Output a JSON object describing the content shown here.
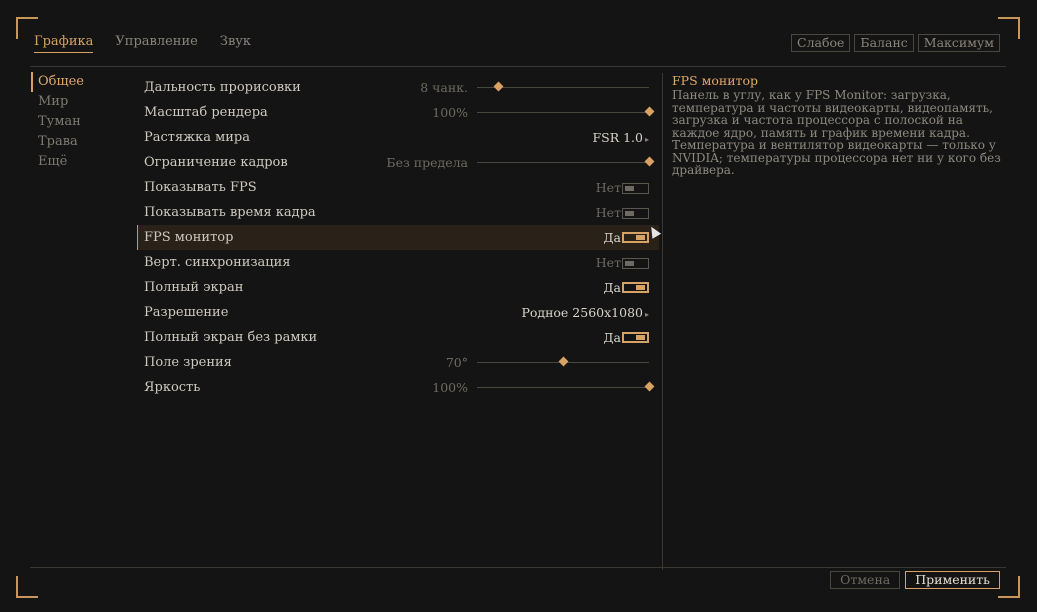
{
  "tabs": [
    {
      "label": "Графика",
      "active": true
    },
    {
      "label": "Управление",
      "active": false
    },
    {
      "label": "Звук",
      "active": false
    }
  ],
  "presets": [
    "Слабое",
    "Баланс",
    "Максимум"
  ],
  "sidebar": [
    {
      "label": "Общее",
      "active": true
    },
    {
      "label": "Мир",
      "active": false
    },
    {
      "label": "Туман",
      "active": false
    },
    {
      "label": "Трава",
      "active": false
    },
    {
      "label": "Ещё",
      "active": false
    }
  ],
  "settings": [
    {
      "label": "Дальность прорисовки",
      "type": "slider",
      "value": "8 чанк.",
      "level": 0.12
    },
    {
      "label": "Масштаб рендера",
      "type": "slider",
      "value": "100%",
      "level": 1.0
    },
    {
      "label": "Растяжка мира",
      "type": "select",
      "value": "FSR 1.0"
    },
    {
      "label": "Ограничение кадров",
      "type": "slider",
      "value": "Без предела",
      "level": 1.0
    },
    {
      "label": "Показывать FPS",
      "type": "toggle",
      "value": "Нет",
      "on": false
    },
    {
      "label": "Показывать время кадра",
      "type": "toggle",
      "value": "Нет",
      "on": false
    },
    {
      "label": "FPS монитор",
      "type": "toggle",
      "value": "Да",
      "on": true,
      "highlight": true
    },
    {
      "label": "Верт. синхронизация",
      "type": "toggle",
      "value": "Нет",
      "on": false
    },
    {
      "label": "Полный экран",
      "type": "toggle",
      "value": "Да",
      "on": true
    },
    {
      "label": "Разрешение",
      "type": "select",
      "value": "Родное 2560x1080"
    },
    {
      "label": "Полный экран без рамки",
      "type": "toggle",
      "value": "Да",
      "on": true
    },
    {
      "label": "Поле зрения",
      "type": "slider",
      "value": "70°",
      "level": 0.5
    },
    {
      "label": "Яркость",
      "type": "slider",
      "value": "100%",
      "level": 1.0
    }
  ],
  "info": {
    "title": "FPS монитор",
    "text": "Панель в углу, как у FPS Monitor: загрузка, температура и частоты видеокарты, видеопамять, загрузка и частота процессора с полоской на каждое ядро, память и график времени кадра. Температура и вентилятор видеокарты — только у NVIDIA; температуры процессора нет ни у кого без драйвера."
  },
  "footer": {
    "cancel_label": "Отмена",
    "apply_label": "Применить"
  },
  "colors": {
    "accent": "#d8a265",
    "background": "#141414"
  }
}
